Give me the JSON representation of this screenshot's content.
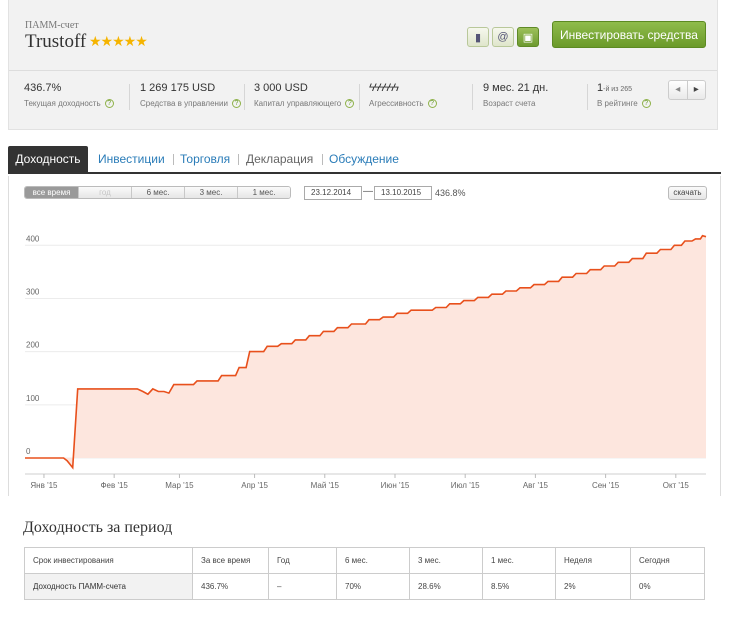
{
  "account": {
    "type_label": "ПАММ-счет",
    "name": "Trustoff",
    "rating_stars": 5,
    "stars_text": "★★★★★"
  },
  "actions": {
    "invest_label": "Инвестировать средства",
    "icon_bookmark": "bookmark-icon",
    "icon_email": "email-icon",
    "icon_portfolio": "briefcase-icon"
  },
  "stats": [
    {
      "value": "436.7%",
      "label": "Текущая доходность"
    },
    {
      "value": "1 269 175 USD",
      "label": "Средства в управлении"
    },
    {
      "value": "3 000 USD",
      "label": "Капитал управляющего"
    },
    {
      "value": "ϟϟϟϟϟϟ",
      "label": "Агрессивность"
    },
    {
      "value": "9 мес. 21 дн.",
      "label": "Возраст счета"
    }
  ],
  "rating": {
    "value": "1",
    "suffix": "-й из 265",
    "label": "В рейтинге"
  },
  "pager": {
    "prev": "◂",
    "next": "▸"
  },
  "tabs": [
    {
      "label": "Доходность",
      "active": true
    },
    {
      "label": "Инвестиции"
    },
    {
      "label": "Торговля"
    },
    {
      "label": "Декларация"
    },
    {
      "label": "Обсуждение"
    }
  ],
  "period_buttons": [
    {
      "label": "все время",
      "state": "on"
    },
    {
      "label": "год",
      "state": "dis"
    },
    {
      "label": "6 мес.",
      "state": ""
    },
    {
      "label": "3 мес.",
      "state": ""
    },
    {
      "label": "1 мес.",
      "state": ""
    }
  ],
  "range": {
    "from": "23.12.2014",
    "separator": "—",
    "to": "13.10.2015",
    "return": "436.8%"
  },
  "download_label": "скачать",
  "chart_data": {
    "type": "area",
    "color": "#e8501c",
    "fill": "#fde6de",
    "y_ticks": [
      0,
      100,
      200,
      300,
      400
    ],
    "x_ticks": [
      "Янв '15",
      "Фев '15",
      "Мар '15",
      "Апр '15",
      "Май '15",
      "Июн '15",
      "Июл '15",
      "Авг '15",
      "Сен '15",
      "Окт '15"
    ],
    "x_tick_months": [
      0.27,
      1.27,
      2.2,
      3.27,
      4.27,
      5.27,
      6.27,
      7.27,
      8.27,
      9.27
    ],
    "ylim": [
      -30,
      455
    ],
    "xlim": [
      0,
      9.7
    ],
    "points": [
      [
        0,
        0
      ],
      [
        0.55,
        0
      ],
      [
        0.6,
        -5
      ],
      [
        0.68,
        -18
      ],
      [
        0.75,
        130
      ],
      [
        1.5,
        130
      ],
      [
        1.6,
        130
      ],
      [
        1.68,
        125
      ],
      [
        1.75,
        120
      ],
      [
        1.82,
        130
      ],
      [
        1.9,
        125
      ],
      [
        1.98,
        125
      ],
      [
        2.05,
        122
      ],
      [
        2.12,
        138
      ],
      [
        2.4,
        138
      ],
      [
        2.45,
        145
      ],
      [
        2.75,
        145
      ],
      [
        2.8,
        155
      ],
      [
        3.0,
        155
      ],
      [
        3.05,
        170
      ],
      [
        3.15,
        170
      ],
      [
        3.2,
        200
      ],
      [
        3.4,
        200
      ],
      [
        3.45,
        210
      ],
      [
        3.6,
        210
      ],
      [
        3.65,
        215
      ],
      [
        3.8,
        215
      ],
      [
        3.85,
        222
      ],
      [
        4.0,
        222
      ],
      [
        4.05,
        230
      ],
      [
        4.2,
        230
      ],
      [
        4.25,
        238
      ],
      [
        4.4,
        238
      ],
      [
        4.45,
        245
      ],
      [
        4.6,
        245
      ],
      [
        4.65,
        252
      ],
      [
        4.85,
        252
      ],
      [
        4.9,
        260
      ],
      [
        5.05,
        260
      ],
      [
        5.1,
        265
      ],
      [
        5.25,
        265
      ],
      [
        5.3,
        272
      ],
      [
        5.45,
        272
      ],
      [
        5.5,
        278
      ],
      [
        5.8,
        278
      ],
      [
        5.85,
        283
      ],
      [
        6.0,
        283
      ],
      [
        6.05,
        290
      ],
      [
        6.2,
        290
      ],
      [
        6.25,
        296
      ],
      [
        6.4,
        296
      ],
      [
        6.45,
        302
      ],
      [
        6.6,
        302
      ],
      [
        6.65,
        308
      ],
      [
        6.8,
        308
      ],
      [
        6.85,
        314
      ],
      [
        7.0,
        314
      ],
      [
        7.05,
        320
      ],
      [
        7.2,
        320
      ],
      [
        7.25,
        326
      ],
      [
        7.4,
        326
      ],
      [
        7.45,
        332
      ],
      [
        7.6,
        332
      ],
      [
        7.65,
        340
      ],
      [
        7.8,
        340
      ],
      [
        7.85,
        347
      ],
      [
        8.0,
        347
      ],
      [
        8.05,
        354
      ],
      [
        8.2,
        354
      ],
      [
        8.25,
        361
      ],
      [
        8.4,
        361
      ],
      [
        8.45,
        368
      ],
      [
        8.6,
        368
      ],
      [
        8.65,
        375
      ],
      [
        8.8,
        375
      ],
      [
        8.85,
        385
      ],
      [
        9.0,
        385
      ],
      [
        9.05,
        392
      ],
      [
        9.2,
        392
      ],
      [
        9.25,
        400
      ],
      [
        9.35,
        400
      ],
      [
        9.4,
        408
      ],
      [
        9.5,
        408
      ],
      [
        9.55,
        412
      ],
      [
        9.62,
        412
      ],
      [
        9.65,
        418
      ],
      [
        9.7,
        416
      ]
    ]
  },
  "period_section": {
    "title": "Доходность за период",
    "headers": [
      "Срок инвестирования",
      "За все время",
      "Год",
      "6 мес.",
      "3 мес.",
      "1 мес.",
      "Неделя",
      "Сегодня"
    ],
    "row_label": "Доходность ПАММ-счета",
    "values": [
      "436.7%",
      "–",
      "70%",
      "28.6%",
      "8.5%",
      "2%",
      "0%"
    ]
  }
}
